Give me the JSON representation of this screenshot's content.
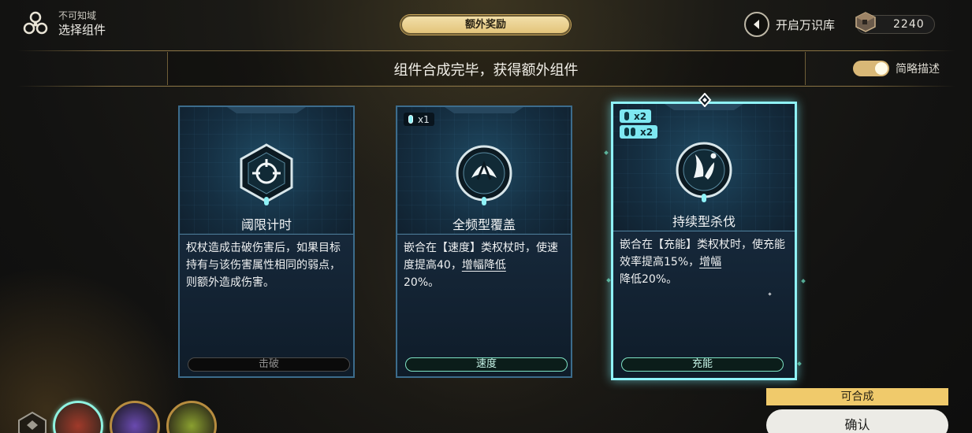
{
  "header": {
    "sub_title": "不可知域",
    "title": "选择组件",
    "bonus_pill": "额外奖励",
    "codex_label": "开启万识库",
    "currency_value": "2240"
  },
  "banner": {
    "title": "组件合成完毕，获得额外组件",
    "toggle_label": "简略描述",
    "toggle_on": true
  },
  "cards": [
    {
      "name": "阈限计时",
      "desc_plain": "权杖造成击破伤害后，如果目标持有与该伤害属性相同的弱点，则额外造成伤害。",
      "tag": "击破",
      "badges": []
    },
    {
      "name": "全频型覆盖",
      "desc_a": "嵌合在【速度】类权杖时，使速度提高40，",
      "desc_u": "增幅降低",
      "desc_b": "20%。",
      "tag": "速度",
      "badges": [
        {
          "label": "x1"
        }
      ]
    },
    {
      "name": "持续型杀伐",
      "desc_a": "嵌合在【充能】类权杖时，使充能效率提高15%，",
      "desc_u": "增幅",
      "desc_b": "降低20%。",
      "tag": "充能",
      "badges": [
        {
          "label": "x2"
        },
        {
          "label": "x2"
        }
      ],
      "selected": true
    }
  ],
  "footer": {
    "can_compose": "可合成",
    "confirm": "确认"
  },
  "colors": {
    "accent_gold": "#f0ca6b",
    "accent_cyan": "#8ff2f7",
    "tag_green": "#7fe3c5"
  }
}
